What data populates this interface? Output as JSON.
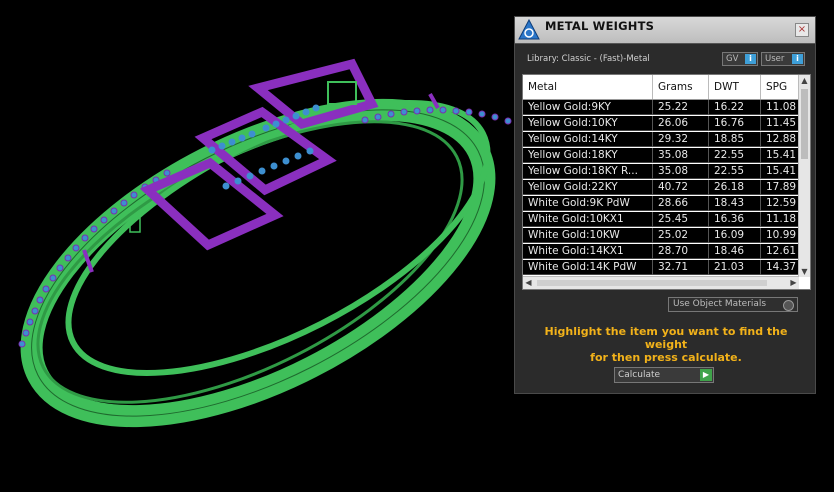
{
  "panel": {
    "title": "METAL WEIGHTS",
    "close": "×",
    "library": "Library: Classic - (Fast)-Metal",
    "gv_label": "GV",
    "user_label": "User",
    "info_glyph": "i",
    "use_object_materials": "Use Object Materials",
    "instruction_line1": "Highlight the item you want to find the weight",
    "instruction_line2": "for then press calculate.",
    "calculate": "Calculate",
    "calculate_go": "▶",
    "scroll_up": "▲",
    "scroll_down": "▼",
    "scroll_left": "◀",
    "scroll_right": "▶"
  },
  "table": {
    "columns": [
      "Metal",
      "Grams",
      "DWT",
      "SPG"
    ],
    "rows": [
      [
        "Yellow Gold:9KY",
        "25.22",
        "16.22",
        "11.08"
      ],
      [
        "Yellow Gold:10KY",
        "26.06",
        "16.76",
        "11.45"
      ],
      [
        "Yellow Gold:14KY",
        "29.32",
        "18.85",
        "12.88"
      ],
      [
        "Yellow Gold:18KY",
        "35.08",
        "22.55",
        "15.41"
      ],
      [
        "Yellow Gold:18KY R...",
        "35.08",
        "22.55",
        "15.41"
      ],
      [
        "Yellow Gold:22KY",
        "40.72",
        "26.18",
        "17.89"
      ],
      [
        "White Gold:9K PdW",
        "28.66",
        "18.43",
        "12.59"
      ],
      [
        "White Gold:10KX1",
        "25.45",
        "16.36",
        "11.18"
      ],
      [
        "White Gold:10KW",
        "25.02",
        "16.09",
        "10.99"
      ],
      [
        "White Gold:14KX1",
        "28.70",
        "18.46",
        "12.61"
      ],
      [
        "White Gold:14K PdW",
        "32.71",
        "21.03",
        "14.37"
      ]
    ]
  },
  "colors": {
    "accent_orange": "#f2b21a",
    "info_blue": "#3e9fd8",
    "go_green": "#3fa34a",
    "band_green": "#3fbf5a",
    "setting_purple": "#8a2fbf",
    "stone_blue": "#3d8fd0"
  },
  "icons": [
    "app-logo-icon",
    "close-icon",
    "info-icon",
    "radio-icon",
    "arrow-right-icon",
    "chevron-up-icon",
    "chevron-down-icon",
    "chevron-left-icon",
    "chevron-right-icon"
  ]
}
